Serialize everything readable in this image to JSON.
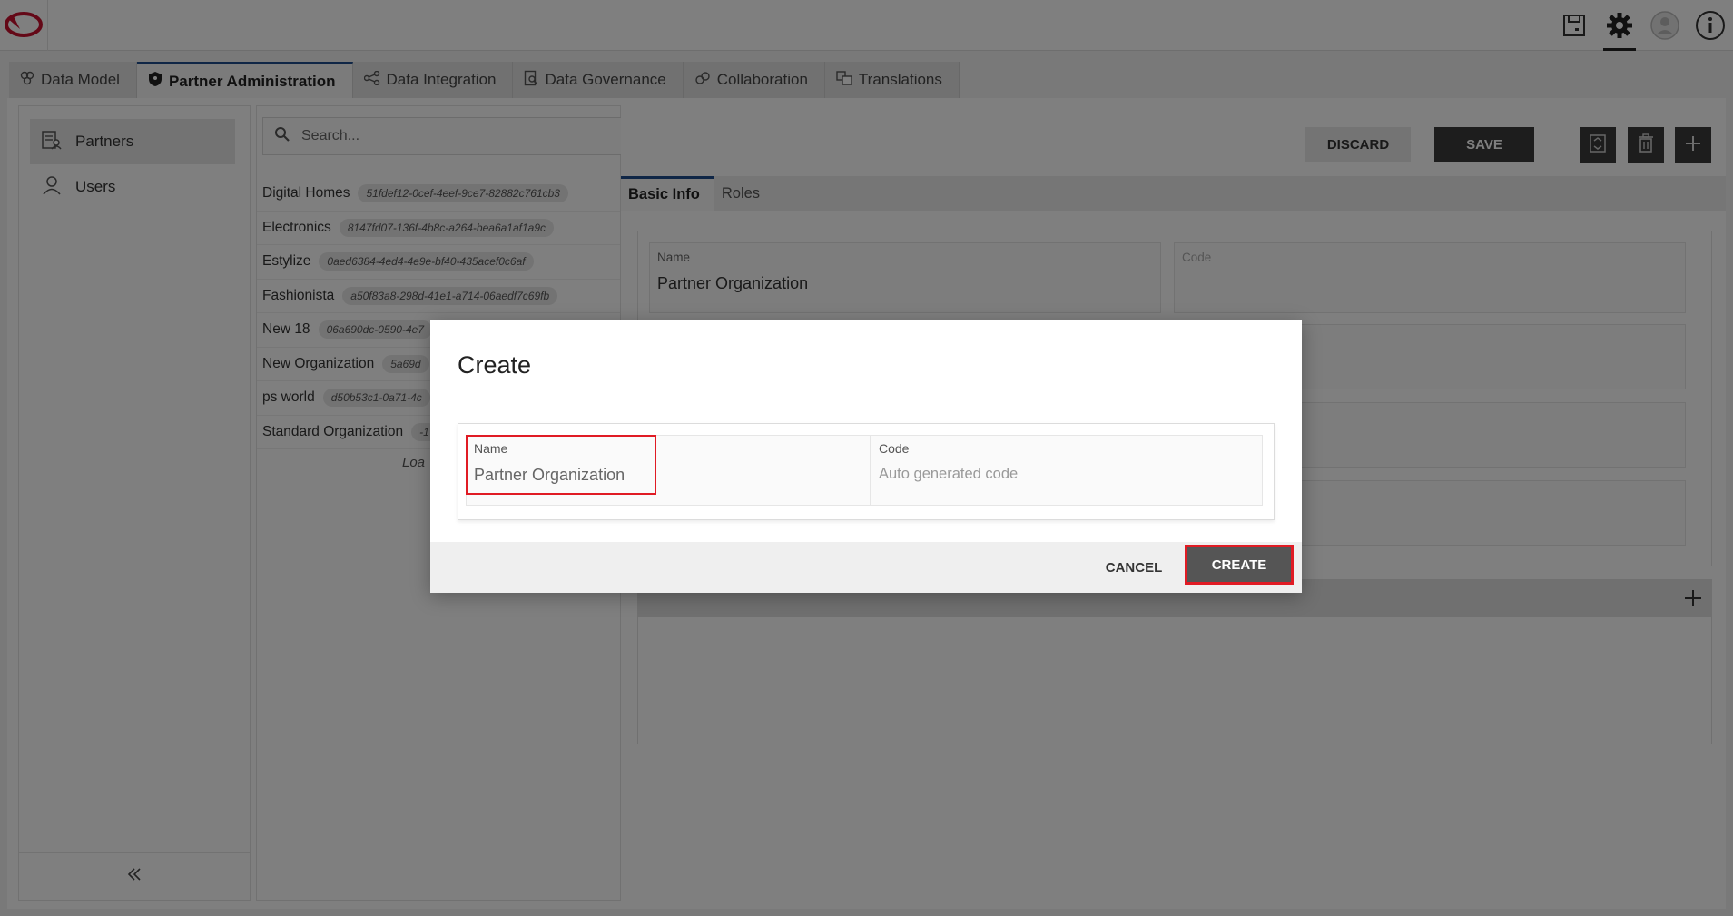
{
  "header": {
    "icons": [
      "save-drafts-icon",
      "settings-gear-icon",
      "user-avatar-icon",
      "info-icon"
    ],
    "active_icon": "settings-gear-icon"
  },
  "tabs": [
    {
      "label": "Data Model",
      "icon": "data-model-icon"
    },
    {
      "label": "Partner Administration",
      "icon": "shield-icon",
      "active": true
    },
    {
      "label": "Data Integration",
      "icon": "integration-icon"
    },
    {
      "label": "Data Governance",
      "icon": "governance-icon"
    },
    {
      "label": "Collaboration",
      "icon": "collaboration-icon"
    },
    {
      "label": "Translations",
      "icon": "translations-icon"
    }
  ],
  "sidebar": {
    "items": [
      {
        "label": "Partners",
        "icon": "partners-icon",
        "active": true
      },
      {
        "label": "Users",
        "icon": "user-icon"
      }
    ]
  },
  "search": {
    "placeholder": "Search..."
  },
  "partners": [
    {
      "name": "Digital Homes",
      "id": "51fdef12-0cef-4eef-9ce7-82882c761cb3"
    },
    {
      "name": "Electronics",
      "id": "8147fd07-136f-4b8c-a264-bea6a1af1a9c"
    },
    {
      "name": "Estylize",
      "id": "0aed6384-4ed4-4e9e-bf40-435acef0c6af"
    },
    {
      "name": "Fashionista",
      "id": "a50f83a8-298d-41e1-a714-06aedf7c69fb"
    },
    {
      "name": "New 18",
      "id": "06a690dc-0590-4e7"
    },
    {
      "name": "New Organization",
      "id": "5a69d"
    },
    {
      "name": "ps world",
      "id": "d50b53c1-0a71-4c"
    },
    {
      "name": "Standard Organization",
      "id": "-1"
    }
  ],
  "list_loading": "Loa",
  "toolbar": {
    "discard": "DISCARD",
    "save": "SAVE"
  },
  "detail": {
    "tabs": [
      {
        "label": "Basic Info",
        "active": true
      },
      {
        "label": "Roles"
      }
    ],
    "name_label": "Name",
    "name_value": "Partner Organization",
    "code_label": "Code"
  },
  "modal": {
    "title": "Create",
    "name_label": "Name",
    "name_value": "Partner Organization",
    "code_label": "Code",
    "code_placeholder": "Auto generated code",
    "cancel": "CANCEL",
    "create": "CREATE"
  },
  "colors": {
    "accent": "#1f4d8c",
    "brand_red": "#c8102e",
    "highlight": "#e01b24"
  }
}
